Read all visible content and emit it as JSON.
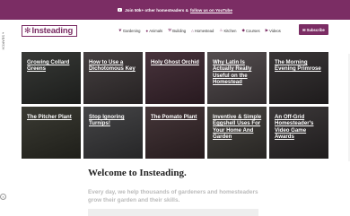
{
  "topbar": {
    "text": "Join 50k+ other homesteaders &",
    "link": "follow us on YouTube",
    "icon": "youtube-icon"
  },
  "header": {
    "logo_text": "Insteading",
    "nav": [
      {
        "label": "Gardening",
        "icon": "leaf-icon"
      },
      {
        "label": "Animals",
        "icon": "paw-icon"
      },
      {
        "label": "Building",
        "icon": "hammer-icon"
      },
      {
        "label": "Homestead",
        "icon": "home-icon"
      },
      {
        "label": "Kitchen",
        "icon": "spoon-icon"
      },
      {
        "label": "Courses",
        "icon": "graduation-icon"
      },
      {
        "label": "Videos",
        "icon": "play-icon"
      }
    ],
    "subscribe_label": "Subscribe"
  },
  "search_tab_label": "SEARCH",
  "tiles": [
    {
      "title": "Growing Collard Greens"
    },
    {
      "title": "How to Use a Dichotomous Key"
    },
    {
      "title": "Holy Ghost Orchid"
    },
    {
      "title": "Why Latin Is Actually Really Useful on the Homestead"
    },
    {
      "title": "The Morning Evening Primrose"
    },
    {
      "title": "The Pitcher Plant"
    },
    {
      "title": "Stop Ignoring Turnips!"
    },
    {
      "title": "The Pomato Plant"
    },
    {
      "title": "Inventive & Simple Eggshell Uses For Your Home And Garden"
    },
    {
      "title": "An Off-Grid Homesteader's Video Game Awards"
    }
  ],
  "welcome": {
    "heading": "Welcome to Insteading.",
    "intro": "Every day, we help thousands of gardeners and homesteaders grow their garden and their skills."
  },
  "colors": {
    "brand": "#7b2d64"
  }
}
